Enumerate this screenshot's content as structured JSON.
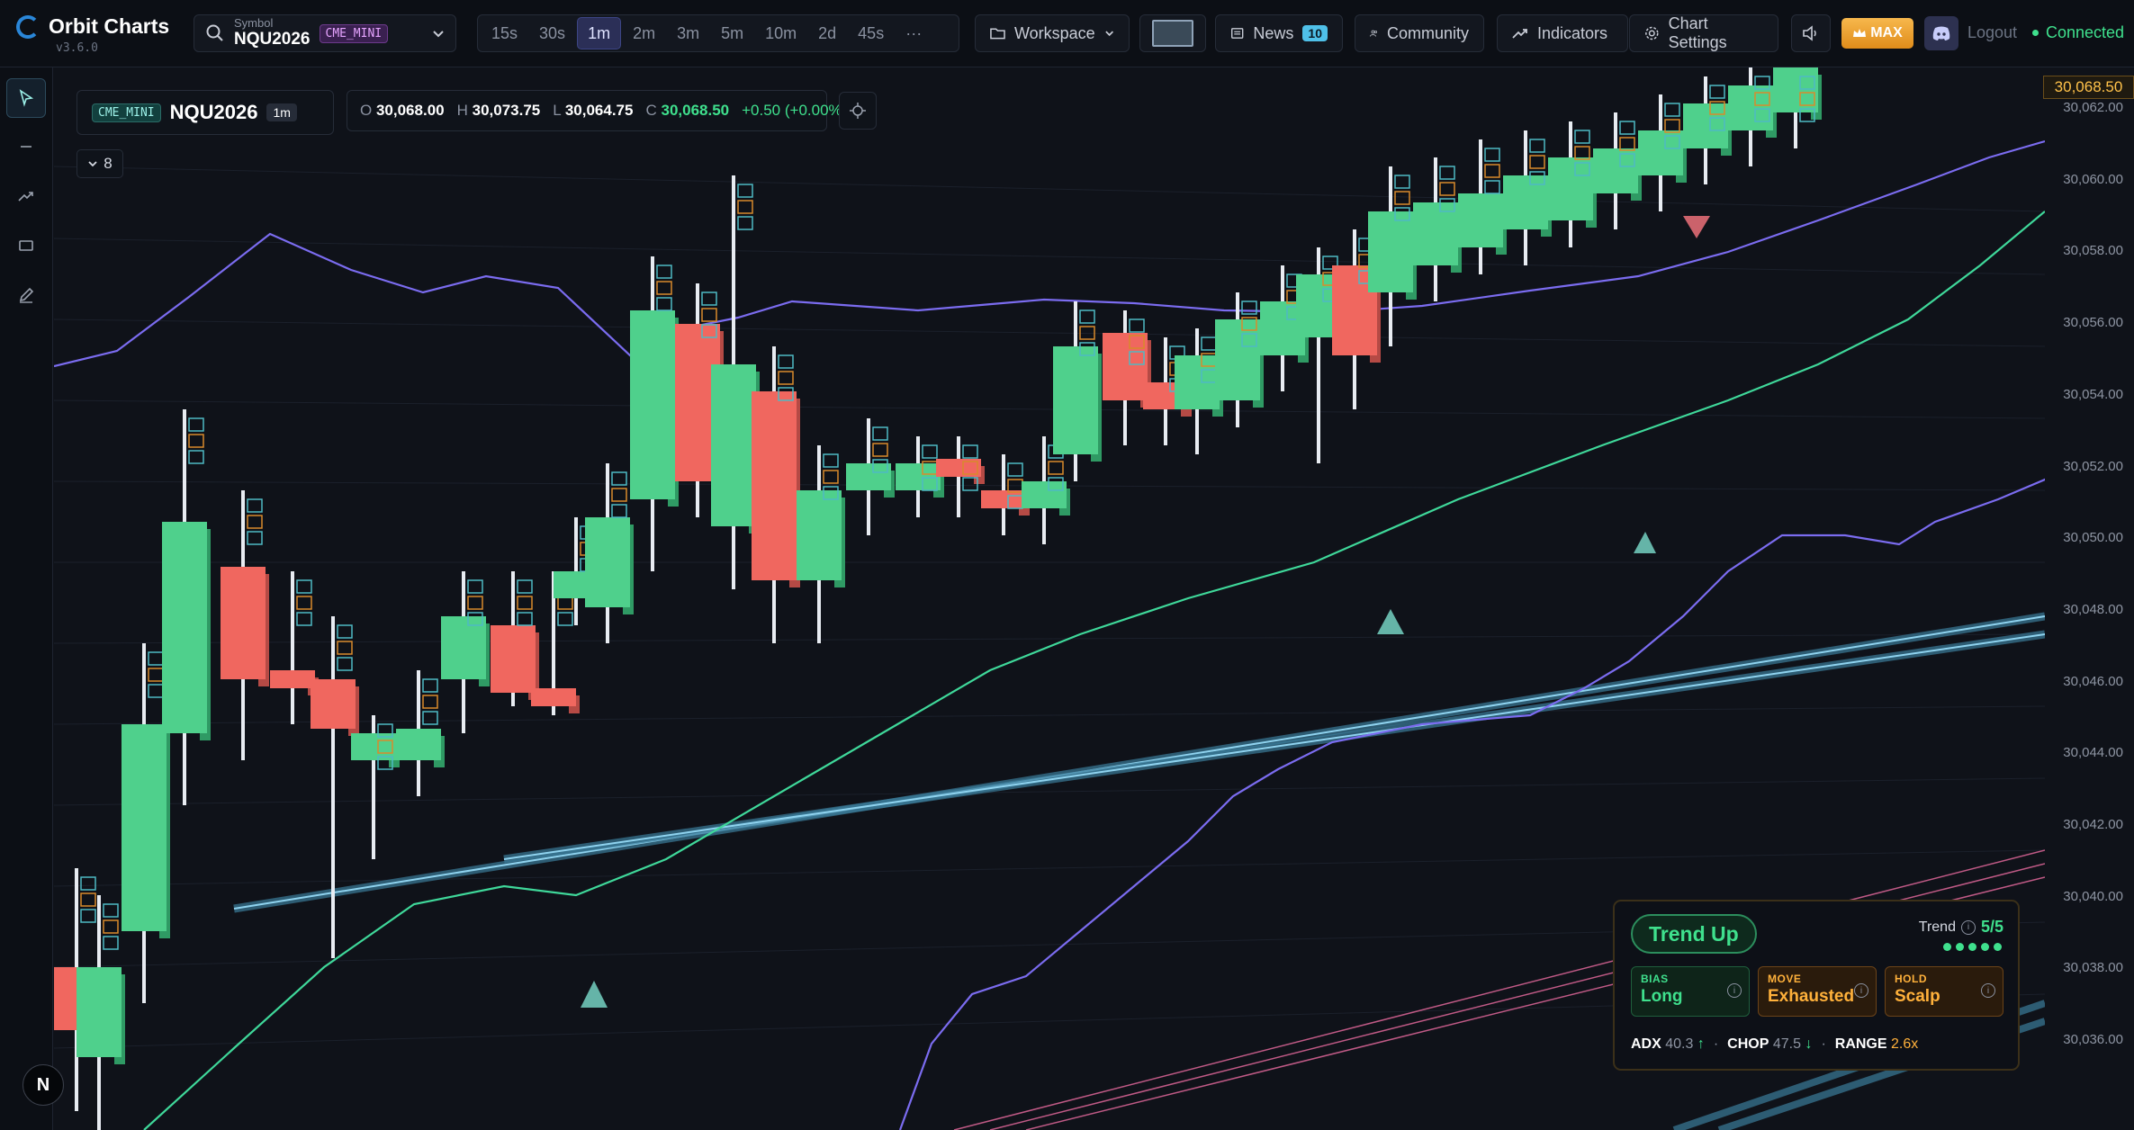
{
  "app": {
    "title": "Orbit Charts",
    "version": "v3.6.0"
  },
  "symbol": {
    "label": "Symbol",
    "value": "NQU2026",
    "exchange": "CME_MINI"
  },
  "timeframes": [
    "15s",
    "30s",
    "1m",
    "2m",
    "3m",
    "5m",
    "10m",
    "2d",
    "45s"
  ],
  "active_timeframe": "1m",
  "toolbar": {
    "more": "···",
    "workspace": "Workspace",
    "news": "News",
    "news_count": "10",
    "community": "Community",
    "indicators": "Indicators",
    "chart_settings": "Chart Settings",
    "max": "MAX",
    "logout": "Logout",
    "status": "Connected"
  },
  "legend": {
    "exchange": "CME_MINI",
    "symbol": "NQU2026",
    "tf": "1m",
    "open_label": "O",
    "open": "30,068.00",
    "high_label": "H",
    "high": "30,073.75",
    "low_label": "L",
    "low": "30,064.75",
    "close_label": "C",
    "close": "30,068.50",
    "change": "+0.50 (+0.00%)",
    "indicator_count": "8"
  },
  "price_axis": {
    "labels": [
      "30,062.00",
      "30,060.00",
      "30,058.00",
      "30,056.00",
      "30,054.00",
      "30,052.00",
      "30,050.00",
      "30,048.00",
      "30,046.00",
      "30,044.00",
      "30,042.00",
      "30,040.00",
      "30,038.00",
      "30,036.00"
    ],
    "last_price": "30,068.50"
  },
  "trend_panel": {
    "state": "Trend Up",
    "score_label": "Trend",
    "score": "5/5",
    "cards": [
      {
        "key": "BIAS",
        "value": "Long",
        "color": "#3fe08d"
      },
      {
        "key": "MOVE",
        "value": "Exhausted",
        "color": "#ffb13b"
      },
      {
        "key": "HOLD",
        "value": "Scalp",
        "color": "#ffb13b"
      }
    ],
    "adx_label": "ADX",
    "adx": "40.3",
    "chop_label": "CHOP",
    "chop": "47.5",
    "range_label": "RANGE",
    "range": "2.6x"
  },
  "colors": {
    "up": "#4fd08c",
    "down": "#f0675f",
    "accent": "#4fc0e8",
    "ma_purple": "#7b6cf0",
    "ma_green": "#3fd89a"
  }
}
